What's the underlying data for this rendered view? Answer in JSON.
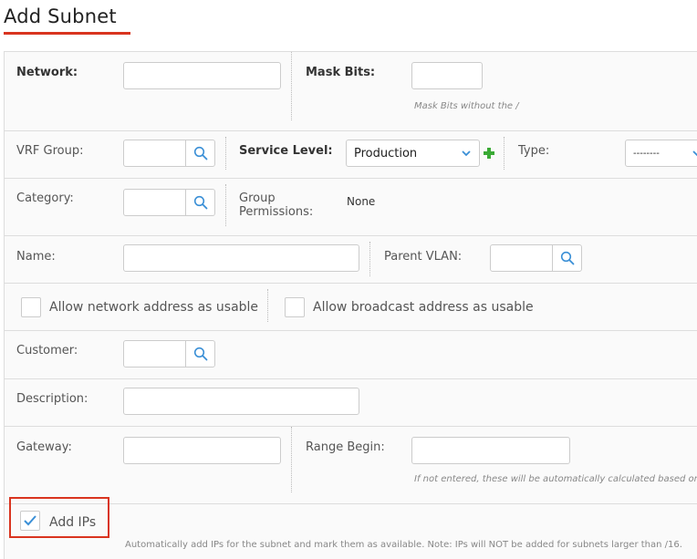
{
  "page": {
    "title": "Add Subnet"
  },
  "network": {
    "label": "Network:",
    "value": "",
    "placeholder": ""
  },
  "mask_bits": {
    "label": "Mask Bits:",
    "value": "",
    "hint": "Mask Bits without the /"
  },
  "vrf_group": {
    "label": "VRF Group:",
    "value": "",
    "search_icon": "search-icon"
  },
  "service_level": {
    "label": "Service Level:",
    "selected": "Production",
    "add_icon": "plus-icon"
  },
  "type": {
    "label": "Type:",
    "selected": "--------"
  },
  "category": {
    "label": "Category:",
    "value": "",
    "search_icon": "search-icon"
  },
  "group_permissions": {
    "label_line1": "Group",
    "label_line2": "Permissions:",
    "value": "None"
  },
  "name": {
    "label": "Name:",
    "value": ""
  },
  "parent_vlan": {
    "label": "Parent VLAN:",
    "value": "",
    "search_icon": "search-icon"
  },
  "allow_network": {
    "label": "Allow network address as usable",
    "checked": false
  },
  "allow_broadcast": {
    "label": "Allow broadcast address as usable",
    "checked": false
  },
  "customer": {
    "label": "Customer:",
    "value": "",
    "search_icon": "search-icon"
  },
  "description": {
    "label": "Description:",
    "value": ""
  },
  "gateway": {
    "label": "Gateway:",
    "value": ""
  },
  "range_begin": {
    "label": "Range Begin:",
    "value": "",
    "hint": "If not entered, these will be automatically calculated based on n"
  },
  "add_ips": {
    "label": "Add IPs",
    "checked": true,
    "hint": "Automatically add IPs for the subnet and mark them as available. Note: IPs will NOT be added for subnets larger than /16."
  },
  "colors": {
    "accent_red": "#d9341f",
    "search_blue": "#3a8fd6",
    "plus_green": "#3aaa35",
    "checkbox_blue": "#3a8fd6"
  }
}
